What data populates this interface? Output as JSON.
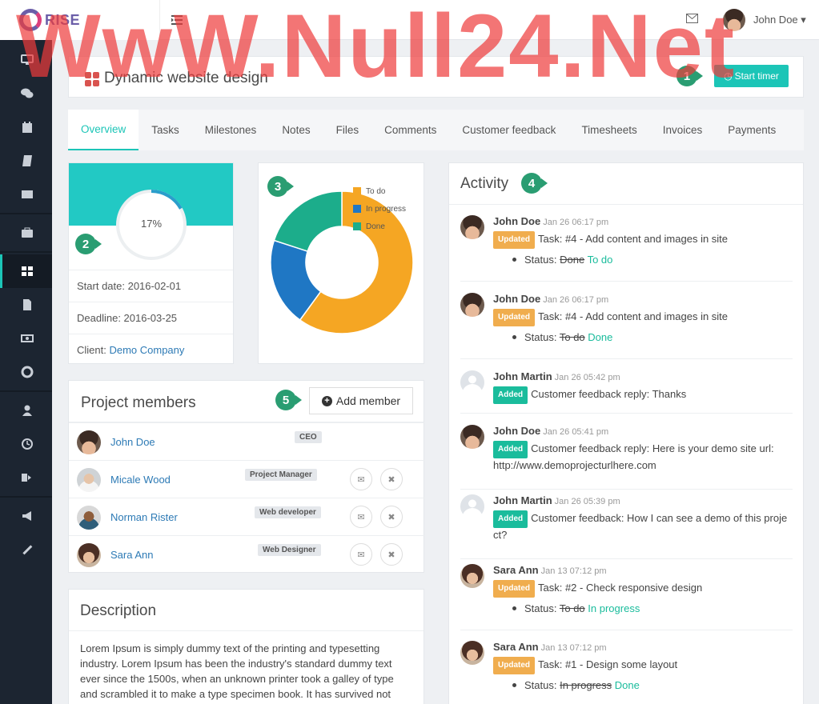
{
  "app": {
    "name": "RISE"
  },
  "topbar": {
    "user_name": "John Doe ▾"
  },
  "project": {
    "title": "Dynamic website design",
    "start_timer_label": "Start timer"
  },
  "tabs": [
    "Overview",
    "Tasks",
    "Milestones",
    "Notes",
    "Files",
    "Comments",
    "Customer feedback",
    "Timesheets",
    "Invoices",
    "Payments"
  ],
  "progress": {
    "percent_label": "17%",
    "percent_value": 0.17,
    "start_date": "Start date: 2016-02-01",
    "deadline": "Deadline: 2016-03-25",
    "client_label": "Client: ",
    "client_name": "Demo Company",
    "band_color": "#22c9c4"
  },
  "chart_data": {
    "type": "pie",
    "categories": [
      "To do",
      "In progress",
      "Done"
    ],
    "values": [
      60,
      20,
      20
    ],
    "colors": [
      "#f5a623",
      "#1f77c4",
      "#1cad8b"
    ],
    "legend_position": "top-right"
  },
  "members": {
    "title": "Project members",
    "add_label": "Add member",
    "list": [
      {
        "name": "John Doe",
        "role": "CEO",
        "avatar": "doe",
        "actions": false
      },
      {
        "name": "Micale Wood",
        "role": "Project Manager",
        "avatar": "micale",
        "actions": true
      },
      {
        "name": "Norman Rister",
        "role": "Web developer",
        "avatar": "norman",
        "actions": true
      },
      {
        "name": "Sara Ann",
        "role": "Web Designer",
        "avatar": "sara",
        "actions": true
      }
    ]
  },
  "description": {
    "title": "Description",
    "text": "Lorem Ipsum is simply dummy text of the printing and typesetting industry. Lorem Ipsum has been the industry's standard dummy text ever since the 1500s, when an unknown printer took a galley of type and scrambled it to make a type specimen book. It has survived not"
  },
  "activity": {
    "title": "Activity",
    "items": [
      {
        "user": "John Doe",
        "time": "Jan 26 06:17 pm",
        "badge": "Updated",
        "text": "Task: #4 - Add content and images in site",
        "status_label": "Status:",
        "old": "Done",
        "new": "To do",
        "avatar": "doe"
      },
      {
        "user": "John Doe",
        "time": "Jan 26 06:17 pm",
        "badge": "Updated",
        "text": "Task: #4 - Add content and images in site",
        "status_label": "Status:",
        "old": "To do",
        "new": "Done",
        "avatar": "doe"
      },
      {
        "user": "John Martin",
        "time": "Jan 26 05:42 pm",
        "badge": "Added",
        "text": "Customer feedback reply: Thanks",
        "avatar": "gen"
      },
      {
        "user": "John Doe",
        "time": "Jan 26 05:41 pm",
        "badge": "Added",
        "text": "Customer feedback reply: Here is your demo site url: http://www.demoprojecturlhere.com",
        "avatar": "doe"
      },
      {
        "user": "John Martin",
        "time": "Jan 26 05:39 pm",
        "badge": "Added",
        "text": "Customer feedback: How I can see a demo of this proje ct?",
        "avatar": "gen"
      },
      {
        "user": "Sara Ann",
        "time": "Jan 13 07:12 pm",
        "badge": "Updated",
        "text": "Task: #2 - Check responsive design",
        "status_label": "Status:",
        "old": "To do",
        "new": "In progress",
        "avatar": "sara"
      },
      {
        "user": "Sara Ann",
        "time": "Jan 13 07:12 pm",
        "badge": "Updated",
        "text": "Task: #1 - Design some layout",
        "status_label": "Status:",
        "old": "In progress",
        "new": "Done",
        "avatar": "sara"
      }
    ]
  },
  "callouts": [
    "1",
    "2",
    "3",
    "4",
    "5"
  ],
  "watermark": "WwW.Null24.Net",
  "sidebar_icons": [
    "desktop-icon",
    "comments-icon",
    "calendar-icon",
    "book-icon",
    "envelope-icon",
    "briefcase-icon",
    "grid-icon",
    "file-icon",
    "money-icon",
    "lifebuoy-icon",
    "user-icon",
    "clock-icon",
    "signout-icon",
    "megaphone-icon",
    "wrench-icon"
  ]
}
